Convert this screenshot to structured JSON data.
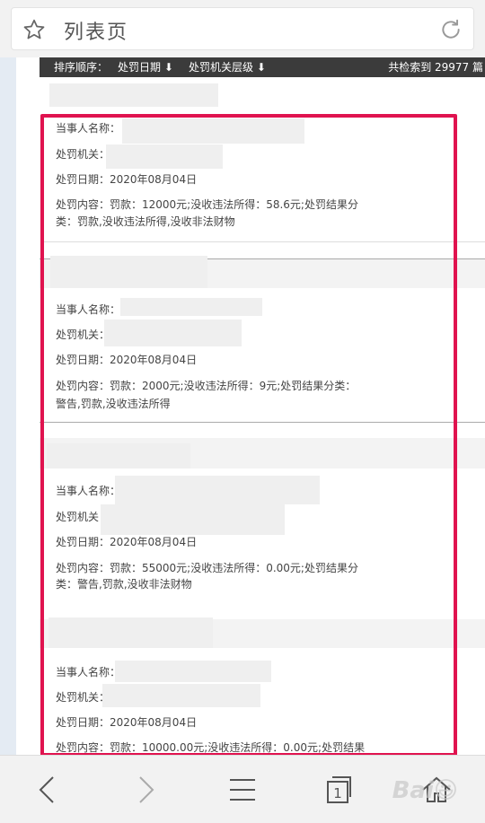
{
  "browser": {
    "title": "列表页"
  },
  "sortbar": {
    "label": "排序顺序：",
    "date": "处罚日期 ⬇",
    "level": "处罚机关层级 ⬇",
    "count": "共检索到 29977 篇"
  },
  "records": [
    {
      "party_label": "当事人名称：",
      "org_label": "处罚机关：",
      "date_line": "处罚日期：2020年08月04日",
      "content_line1": "处罚内容：罚款：12000元;没收违法所得：58.6元;处罚结果分",
      "content_line2": "类：罚款,没收违法所得,没收非法财物"
    },
    {
      "party_label": "当事人名称：",
      "org_label": "处罚机关：",
      "date_line": "处罚日期：2020年08月04日",
      "content_line1": "处罚内容：罚款：2000元;没收违法所得：9元;处罚结果分类：",
      "content_line2": "警告,罚款,没收违法所得"
    },
    {
      "party_label": "当事人名称：",
      "org_label": "处罚机关",
      "date_line": "处罚日期：2020年08月04日",
      "content_line1": "处罚内容：罚款：55000元;没收违法所得：0.00元;处罚结果分",
      "content_line2": "类：警告,罚款,没收非法财物"
    },
    {
      "party_label": "当事人名称：",
      "org_label": "处罚机关：",
      "date_line": "处罚日期：2020年08月04日",
      "content_line1": "处罚内容：罚款：10000.00元;没收违法所得：0.00元;处罚结果",
      "content_line2": ""
    }
  ],
  "bottom": {
    "tab_count": "1",
    "watermark": "Bai😃"
  },
  "colors": {
    "highlight": "#e0134f",
    "sortbar_bg": "#3b3b3b"
  }
}
